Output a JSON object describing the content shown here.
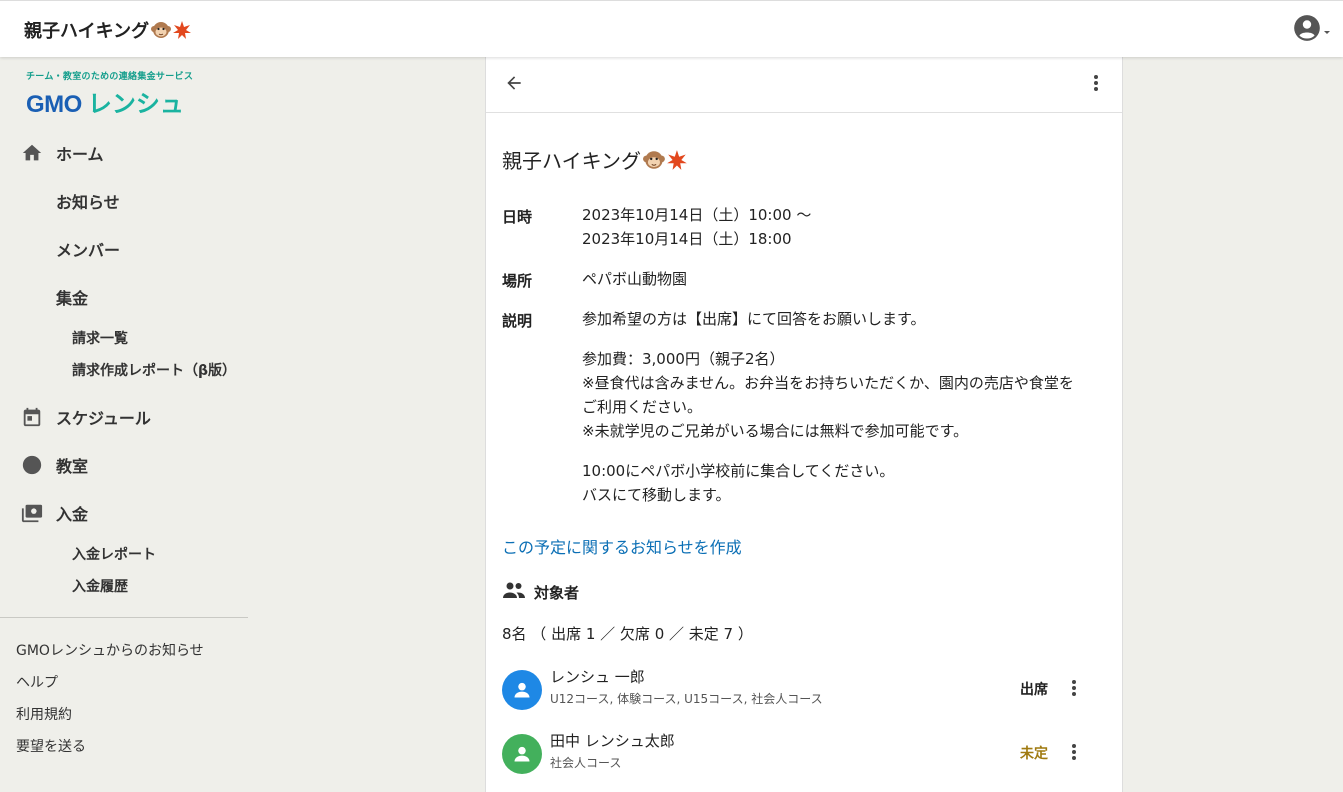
{
  "app": {
    "title": "親子ハイキング"
  },
  "sidebar": {
    "logo_tagline": "チーム・教室のための連絡集金サービス",
    "logo_text_gmo": "GMO",
    "logo_text_lenshu": "レンシュ",
    "items": [
      {
        "label": "ホーム",
        "icon": "home-icon"
      },
      {
        "label": "お知らせ"
      },
      {
        "label": "メンバー"
      },
      {
        "label": "集金"
      },
      {
        "label": "スケジュール",
        "icon": "calendar-icon"
      },
      {
        "label": "教室",
        "icon": "circle-icon"
      },
      {
        "label": "入金",
        "icon": "payment-icon"
      }
    ],
    "sub_billing": [
      "請求一覧",
      "請求作成レポート（β版）"
    ],
    "sub_payment": [
      "入金レポート",
      "入金履歴"
    ],
    "footer_links": [
      "GMOレンシュからのお知らせ",
      "ヘルプ",
      "利用規約",
      "要望を送る"
    ]
  },
  "event": {
    "title": "親子ハイキング",
    "date_label": "日時",
    "date_start": "2023年10月14日（土）10:00 〜",
    "date_end": "2023年10月14日（土）18:00",
    "place_label": "場所",
    "place": "ペパボ山動物園",
    "desc_label": "説明",
    "desc_p1": "参加希望の方は【出席】にて回答をお願いします。",
    "desc_p2_l1": "参加費：3,000円（親子2名）",
    "desc_p2_l2": "※昼食代は含みません。お弁当をお持ちいただくか、園内の売店や食堂を",
    "desc_p2_l3": "ご利用ください。",
    "desc_p2_l4": "※未就学児のご兄弟がいる場合には無料で参加可能です。",
    "desc_p3_l1": "10:00にペパボ小学校前に集合してください。",
    "desc_p3_l2": "バスにて移動します。",
    "notice_link": "この予定に関するお知らせを作成"
  },
  "attendees": {
    "heading": "対象者",
    "summary": "8名 （ 出席 1 ／ 欠席 0 ／ 未定 7 ）",
    "members": [
      {
        "name": "レンシュ 一郎",
        "courses": "U12コース, 体験コース, U15コース, 社会人コース",
        "status": "出席",
        "status_color": "#222222",
        "avatar_color": "#1e88e5"
      },
      {
        "name": "田中 レンシュ太郎",
        "courses": "社会人コース",
        "status": "未定",
        "status_color": "#a07a10",
        "avatar_color": "#43b05c"
      }
    ]
  },
  "colors": {
    "accent_link": "#0b6fb5",
    "logo_teal": "#1ab3a0",
    "logo_blue": "#1a5fb4"
  }
}
